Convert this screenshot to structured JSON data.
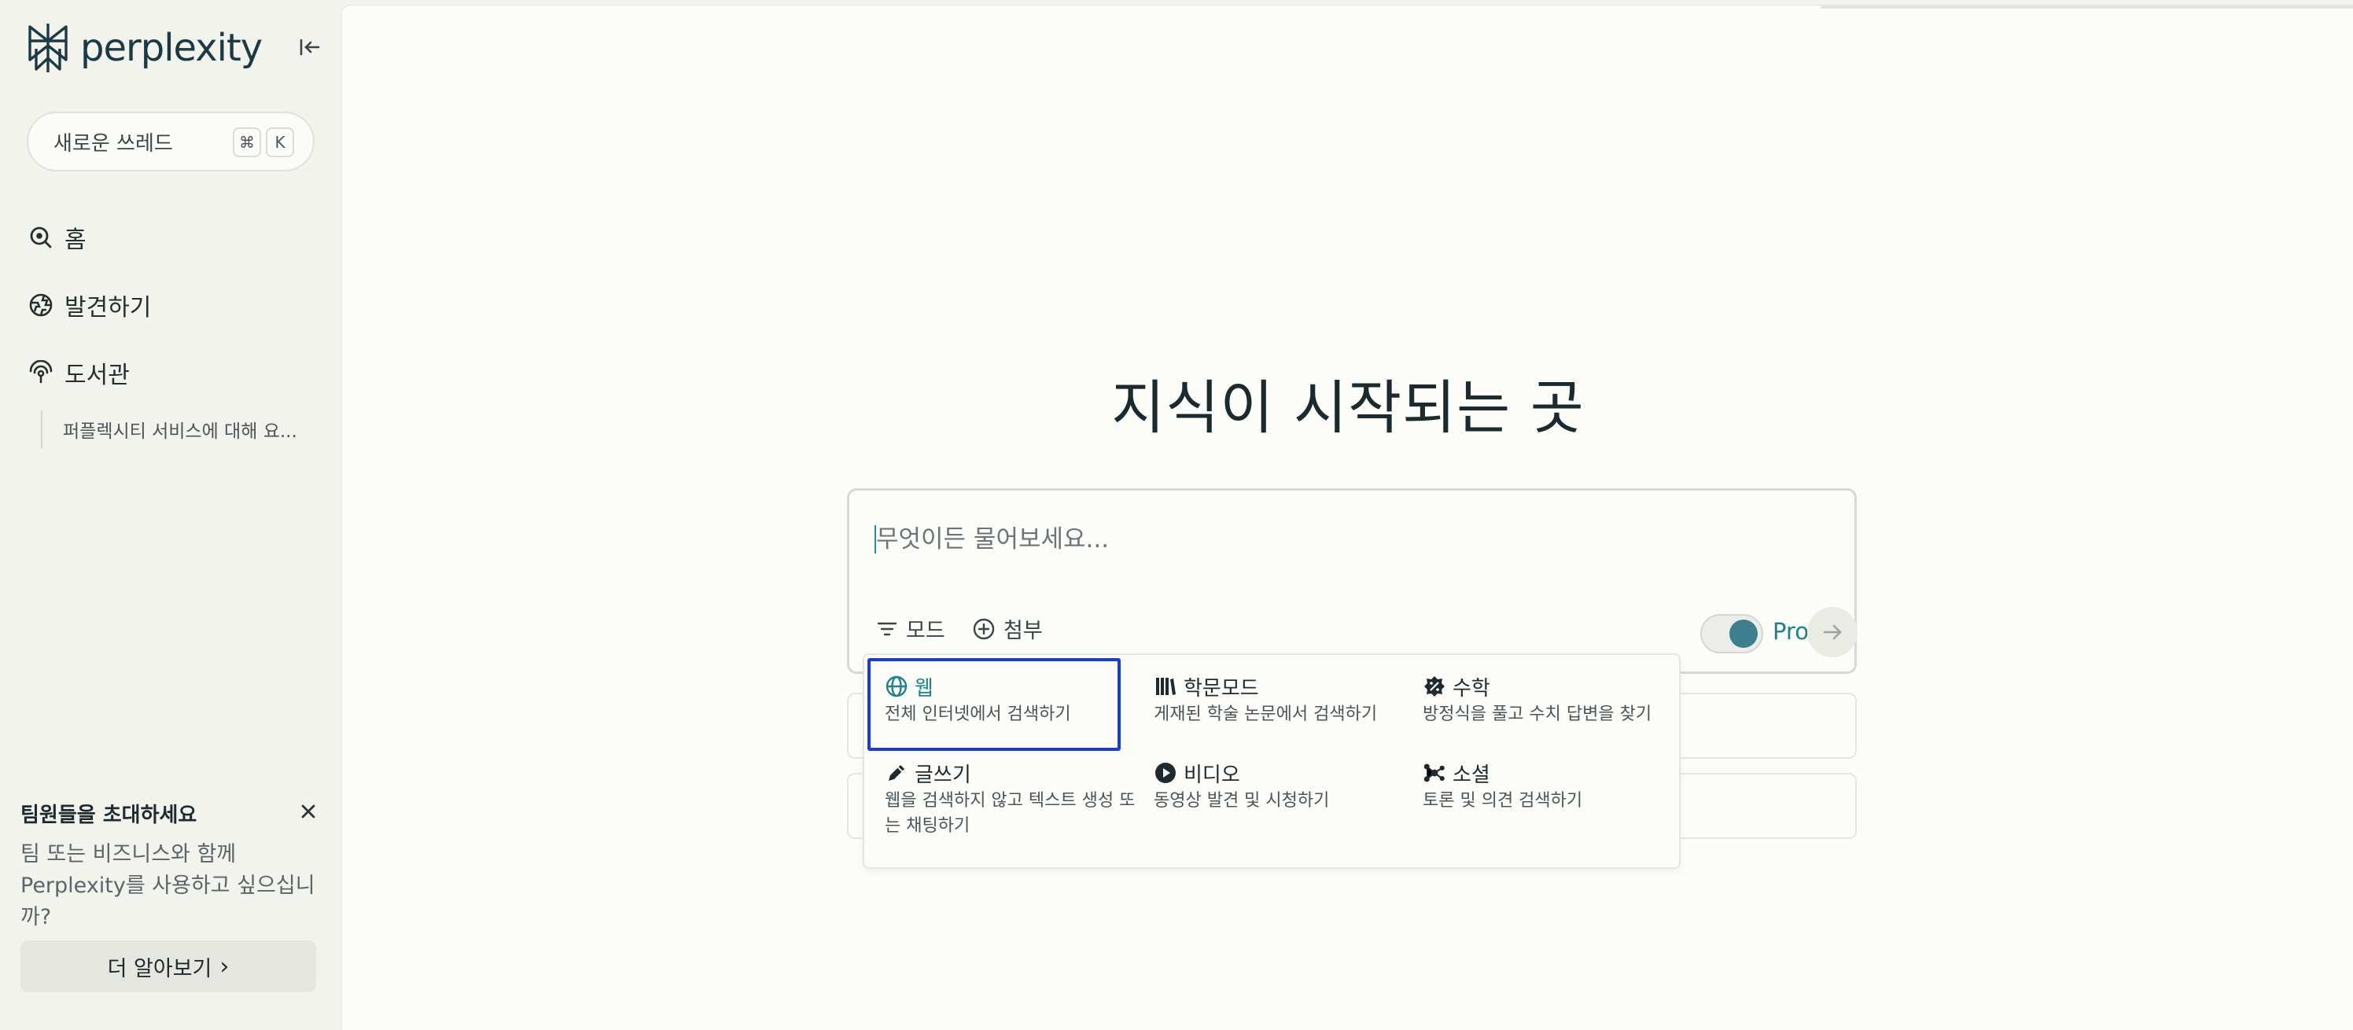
{
  "brand": {
    "name": "perplexity",
    "color": "#1b3a44",
    "accent": "#20808d"
  },
  "sidebar": {
    "new_thread_label": "새로운 쓰레드",
    "shortcut_keys": [
      "⌘",
      "K"
    ],
    "nav": [
      {
        "label": "홈",
        "icon": "search-home-icon"
      },
      {
        "label": "발견하기",
        "icon": "globe-icon"
      },
      {
        "label": "도서관",
        "icon": "library-icon"
      }
    ],
    "library_items": [
      "퍼플렉시티 서비스에 대해 요..."
    ],
    "invite": {
      "title": "팀원들을 초대하세요",
      "body": "팀 또는 비즈니스와 함께 Perplexity를 사용하고 싶으십니까?",
      "button_label": "더 알아보기",
      "button_chevron": "›"
    }
  },
  "main": {
    "headline": "지식이 시작되는 곳",
    "search": {
      "placeholder": "무엇이든 물어보세요...",
      "mode_label": "모드",
      "attach_label": "첨부",
      "pro_label": "Pro",
      "pro_enabled": true
    },
    "mode_menu": [
      {
        "title": "웹",
        "desc": "전체 인터넷에서 검색하기",
        "icon": "globe-icon",
        "selected": true
      },
      {
        "title": "학문모드",
        "desc": "게재된 학술 논문에서 검색하기",
        "icon": "books-icon",
        "selected": false
      },
      {
        "title": "수학",
        "desc": "방정식을 풀고 수치 답변을 찾기",
        "icon": "math-icon",
        "selected": false
      },
      {
        "title": "글쓰기",
        "desc": "웹을 검색하지 않고 텍스트 생성 또는 채팅하기",
        "icon": "pencil-icon",
        "selected": false
      },
      {
        "title": "비디오",
        "desc": "동영상 발견 및 시청하기",
        "icon": "play-icon",
        "selected": false
      },
      {
        "title": "소셜",
        "desc": "토론 및 의견 검색하기",
        "icon": "social-icon",
        "selected": false
      }
    ]
  }
}
